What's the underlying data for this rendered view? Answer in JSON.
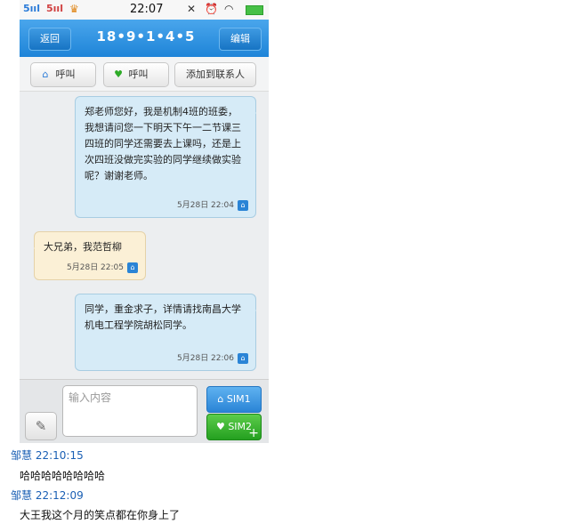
{
  "status_bar": {
    "signal1": "5ııl",
    "signal2": "5ııl",
    "time": "22:07"
  },
  "title_bar": {
    "back_label": "返回",
    "title": "18•9•1•4•5",
    "edit_label": "编辑"
  },
  "action_bar": {
    "call1_label": "呼叫",
    "call2_label": "呼叫",
    "add_contact_label": "添加到联系人"
  },
  "messages": [
    {
      "direction": "outgoing",
      "text": "郑老师您好，我是机制4班的班委，我想请问您一下明天下午一二节课三四班的同学还需要去上课吗，还是上次四班没做完实验的同学继续做实验呢？谢谢老师。",
      "timestamp": "5月28日 22:04"
    },
    {
      "direction": "incoming",
      "text": "大兄弟，我范哲柳",
      "timestamp": "5月28日 22:05"
    },
    {
      "direction": "outgoing",
      "text": "同学，重金求子，详情请找南昌大学机电工程学院胡松同学。",
      "timestamp": "5月28日 22:06"
    }
  ],
  "composer": {
    "placeholder": "输入内容",
    "sim1_label": "SIM1",
    "sim2_label": "SIM2"
  },
  "comments": [
    {
      "author_time": "邹慧  22:10:15",
      "text": "哈哈哈哈哈哈哈哈"
    },
    {
      "author_time": "邹慧  22:12:09",
      "text": "大王我这个月的笑点都在你身上了"
    }
  ],
  "colors": {
    "title_bar": "#2a8ee0",
    "outgoing_bubble": "#d6ebf7",
    "incoming_bubble": "#fbf0d6",
    "sim2_button": "#2eab27",
    "comment_name": "#1a5fb4"
  }
}
